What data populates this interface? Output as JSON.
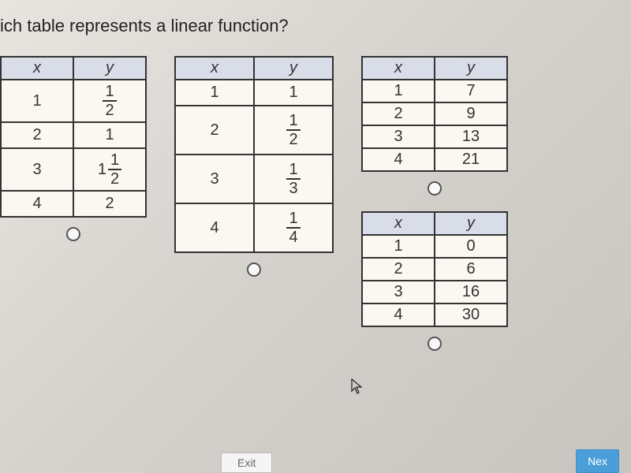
{
  "question": "ich table represents a linear function?",
  "headers": {
    "x": "x",
    "y": "y"
  },
  "table1": {
    "rows": [
      {
        "x": "1",
        "y_num": "1",
        "y_den": "2"
      },
      {
        "x": "2",
        "y": "1"
      },
      {
        "x": "3",
        "y_whole": "1",
        "y_num": "1",
        "y_den": "2"
      },
      {
        "x": "4",
        "y": "2"
      }
    ]
  },
  "table2": {
    "rows": [
      {
        "x": "1",
        "y": "1"
      },
      {
        "x": "2",
        "y_num": "1",
        "y_den": "2"
      },
      {
        "x": "3",
        "y_num": "1",
        "y_den": "3"
      },
      {
        "x": "4",
        "y_num": "1",
        "y_den": "4"
      }
    ]
  },
  "table3": {
    "rows": [
      {
        "x": "1",
        "y": "7"
      },
      {
        "x": "2",
        "y": "9"
      },
      {
        "x": "3",
        "y": "13"
      },
      {
        "x": "4",
        "y": "21"
      }
    ]
  },
  "table4": {
    "rows": [
      {
        "x": "1",
        "y": "0"
      },
      {
        "x": "2",
        "y": "6"
      },
      {
        "x": "3",
        "y": "16"
      },
      {
        "x": "4",
        "y": "30"
      }
    ]
  },
  "buttons": {
    "exit": "Exit",
    "next": "Nex"
  }
}
